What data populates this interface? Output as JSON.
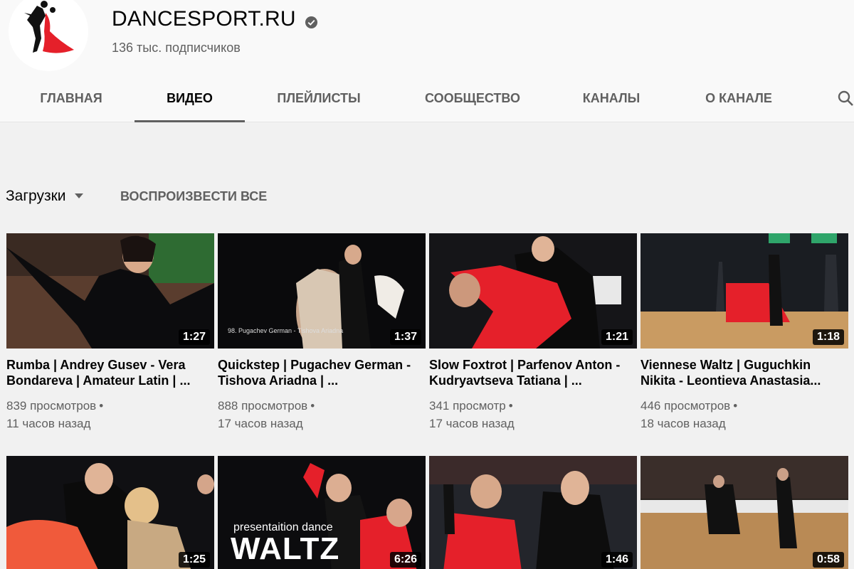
{
  "channel": {
    "name": "DANCESPORT.RU",
    "subscribers": "136 тыс. подписчиков"
  },
  "tabs": [
    {
      "label": "ГЛАВНАЯ"
    },
    {
      "label": "ВИДЕО",
      "active": true
    },
    {
      "label": "ПЛЕЙЛИСТЫ"
    },
    {
      "label": "СООБЩЕСТВО"
    },
    {
      "label": "КАНАЛЫ"
    },
    {
      "label": "О КАНАЛЕ"
    }
  ],
  "icons": {
    "search": "search-icon",
    "verified": "verified-check-icon",
    "caret": "caret-down-icon"
  },
  "filter": {
    "sort_label": "Загрузки",
    "play_all": "ВОСПРОИЗВЕСТИ ВСЕ"
  },
  "videos": [
    {
      "title": "Rumba | Andrey Gusev - Vera Bondareva | Amateur Latin | ...",
      "views": "839 просмотров",
      "age": "11 часов назад",
      "duration": "1:27"
    },
    {
      "title": "Quickstep | Pugachev German - Tishova Ariadna | ...",
      "views": "888 просмотров",
      "age": "17 часов назад",
      "duration": "1:37",
      "caption": "98. Pugachev German - Tishova Ariadna"
    },
    {
      "title": "Slow Foxtrot | Parfenov Anton - Kudryavtseva Tatiana | ...",
      "views": "341 просмотр",
      "age": "17 часов назад",
      "duration": "1:21"
    },
    {
      "title": "Viennese Waltz | Guguchkin Nikita - Leontieva Anastasia...",
      "views": "446 просмотров",
      "age": "18 часов назад",
      "duration": "1:18"
    },
    {
      "title": "",
      "views": "",
      "age": "",
      "duration": "1:25"
    },
    {
      "title": "",
      "views": "",
      "age": "",
      "duration": "6:26",
      "overlay_small": "presentaition dance",
      "overlay_big": "WALTZ"
    },
    {
      "title": "",
      "views": "",
      "age": "",
      "duration": "1:46"
    },
    {
      "title": "",
      "views": "",
      "age": "",
      "duration": "0:58"
    }
  ],
  "colors": {
    "accent_red": "#e5202a",
    "text_primary": "#030303",
    "text_secondary": "#606060",
    "background": "#f9f9f9"
  }
}
